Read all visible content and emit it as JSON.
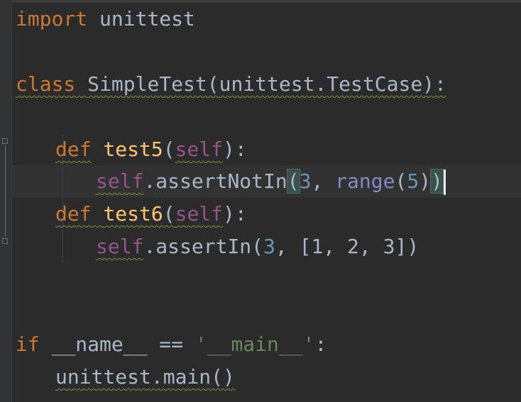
{
  "code": {
    "line1": {
      "kw_import": "import",
      "module": " unittest"
    },
    "line3": {
      "kw_class": "class",
      "sp": " ",
      "class_name": "SimpleTest",
      "open": "(",
      "base": "unittest.TestCase",
      "close": "):"
    },
    "line5": {
      "kw_def": "def",
      "sp": " ",
      "func_name": "test5",
      "open": "(",
      "self": "self",
      "close": "):"
    },
    "line6": {
      "self": "self",
      "method": ".assertNotIn",
      "open_paren": "(",
      "num": "3",
      "comma": ", ",
      "builtin": "range",
      "inner_open": "(",
      "arg": "5",
      "inner_close": ")",
      "close_paren": ")"
    },
    "line7": {
      "kw_def": "def",
      "sp": " ",
      "func_name": "test6",
      "open": "(",
      "self": "self",
      "close": "):"
    },
    "line8": {
      "self": "self",
      "method": ".assertIn",
      "open": "(",
      "num": "3",
      "comma": ", ",
      "list": "[1, 2, 3]",
      "close": ")"
    },
    "line11": {
      "kw_if": "if",
      "sp1": " ",
      "dunder": "__name__",
      "op": " == ",
      "str": "'__main__'",
      "colon": ":"
    },
    "line12": {
      "call": "unittest.main()"
    }
  },
  "colors": {
    "background": "#2b2b2b",
    "keyword": "#cc7832",
    "function": "#ffc66d",
    "self": "#94558d",
    "number": "#6897bb",
    "builtin": "#8888c6",
    "string": "#6a8759",
    "text": "#a9b7c6"
  }
}
